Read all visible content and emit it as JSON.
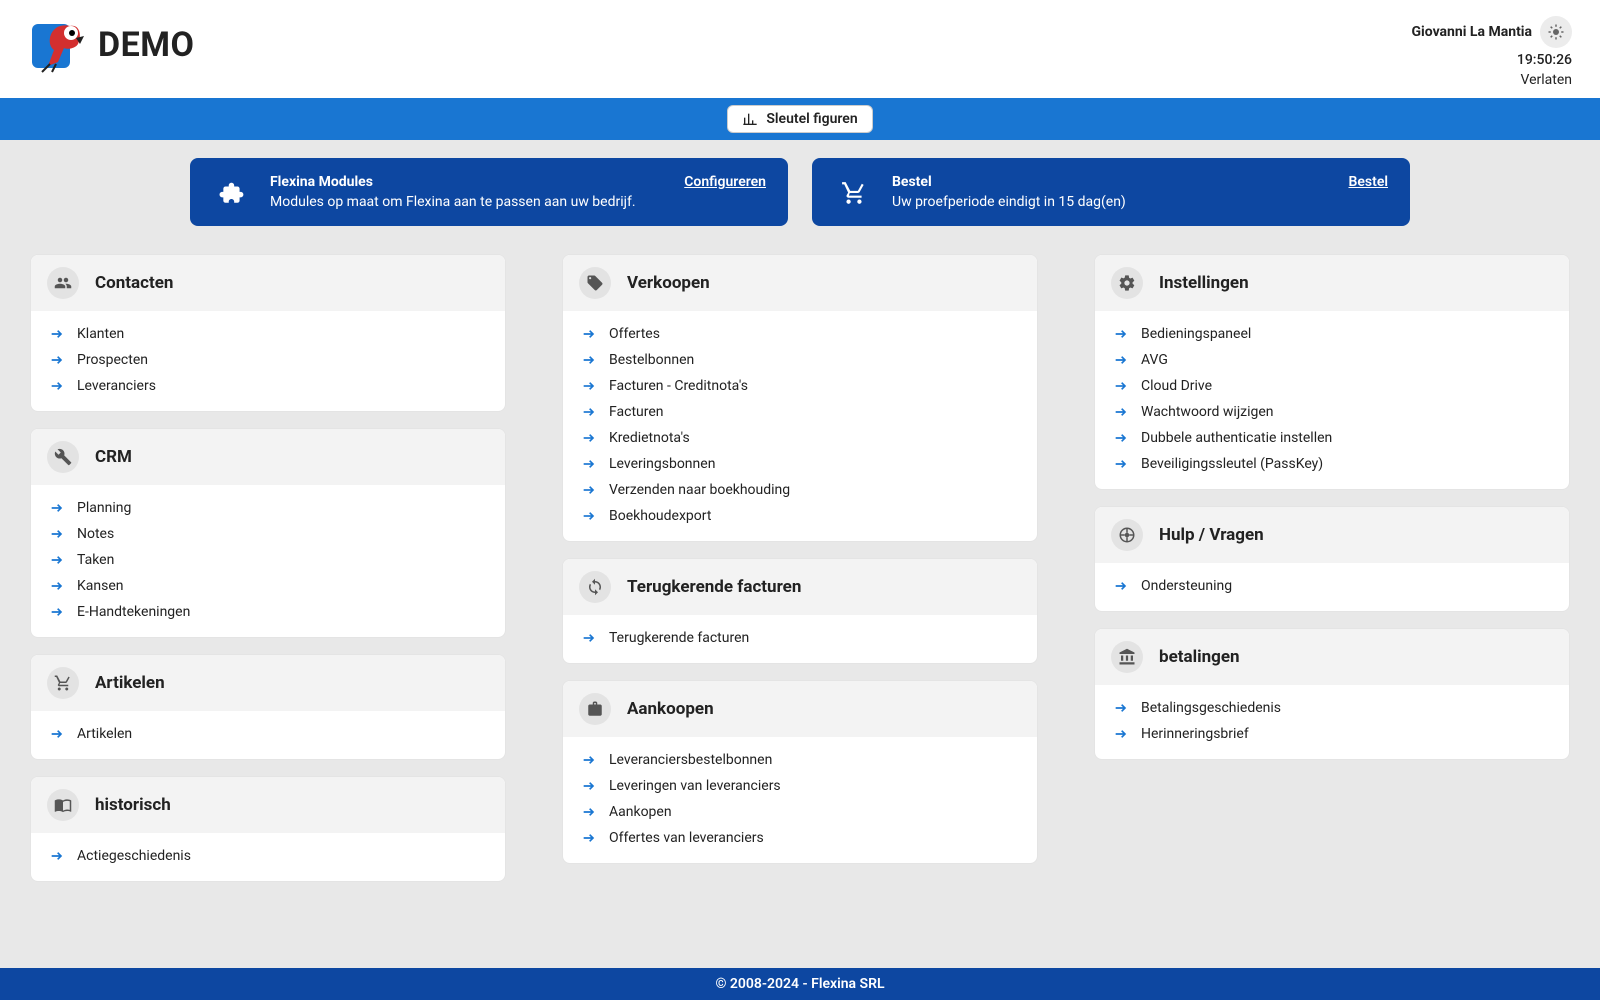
{
  "colors": {
    "brand_blue": "#1976d2",
    "dark_blue": "#0d47a1",
    "arrow": "#1976d2"
  },
  "header": {
    "brand_title": "DEMO",
    "user_name": "Giovanni La Mantia",
    "clock_time": "19:50:26",
    "logout_label": "Verlaten"
  },
  "bluebar": {
    "key_figures_label": "Sleutel figuren"
  },
  "banners": {
    "modules": {
      "title": "Flexina Modules",
      "subtitle": "Modules op maat om Flexina aan te passen aan uw bedrijf.",
      "action_label": "Configureren"
    },
    "order": {
      "title": "Bestel",
      "subtitle": "Uw proefperiode eindigt in 15 dag(en)",
      "action_label": "Bestel"
    }
  },
  "columns": [
    [
      {
        "icon": "people",
        "title": "Contacten",
        "items": [
          "Klanten",
          "Prospecten",
          "Leveranciers"
        ]
      },
      {
        "icon": "tools",
        "title": "CRM",
        "items": [
          "Planning",
          "Notes",
          "Taken",
          "Kansen",
          "E-Handtekeningen"
        ]
      },
      {
        "icon": "cart",
        "title": "Artikelen",
        "items": [
          "Artikelen"
        ]
      },
      {
        "icon": "book",
        "title": "historisch",
        "items": [
          "Actiegeschiedenis"
        ]
      }
    ],
    [
      {
        "icon": "tag",
        "title": "Verkoopen",
        "items": [
          "Offertes",
          "Bestelbonnen",
          "Facturen - Creditnota's",
          "Facturen",
          "Kredietnota's",
          "Leveringsbonnen",
          "Verzenden naar boekhouding",
          "Boekhoudexport"
        ]
      },
      {
        "icon": "refresh",
        "title": "Terugkerende facturen",
        "items": [
          "Terugkerende facturen"
        ]
      },
      {
        "icon": "bag",
        "title": "Aankoopen",
        "items": [
          "Leveranciersbestelbonnen",
          "Leveringen van leveranciers",
          "Aankopen",
          "Offertes van leveranciers"
        ]
      }
    ],
    [
      {
        "icon": "gear",
        "title": "Instellingen",
        "items": [
          "Bedieningspaneel",
          "AVG",
          "Cloud Drive",
          "Wachtwoord wijzigen",
          "Dubbele authenticatie instellen",
          "Beveiligingssleutel (PassKey)"
        ]
      },
      {
        "icon": "help",
        "title": "Hulp / Vragen",
        "items": [
          "Ondersteuning"
        ]
      },
      {
        "icon": "bank",
        "title": "betalingen",
        "items": [
          "Betalingsgeschiedenis",
          "Herinneringsbrief"
        ]
      }
    ]
  ],
  "footer": {
    "copyright": "© 2008-2024 - Flexina SRL"
  }
}
